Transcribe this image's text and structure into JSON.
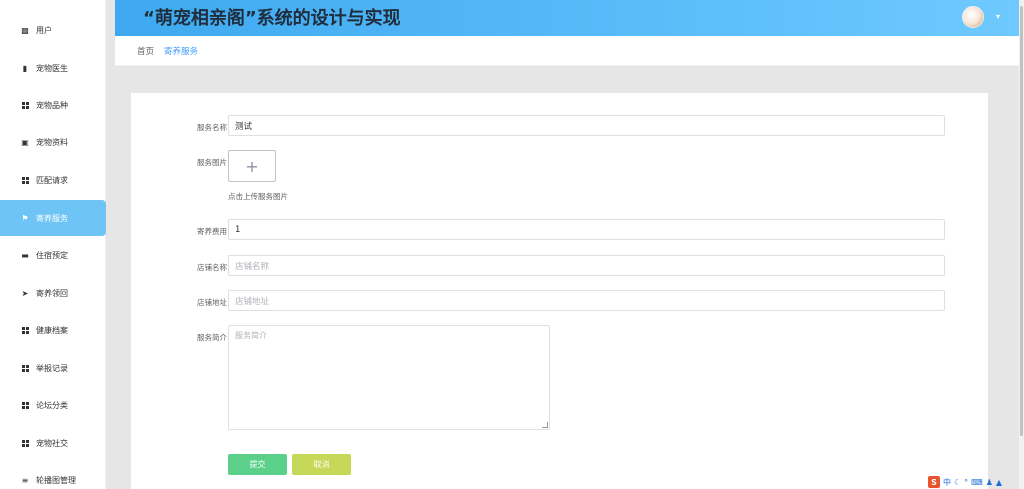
{
  "header": {
    "title": "“萌宠相亲阁”系统的设计与实现"
  },
  "sidebar": {
    "items": [
      {
        "label": "用户",
        "icon": "users-icon"
      },
      {
        "label": "宠物医生",
        "icon": "chart-icon"
      },
      {
        "label": "宠物品种",
        "icon": "grid-icon"
      },
      {
        "label": "宠物资料",
        "icon": "clipboard-icon"
      },
      {
        "label": "匹配请求",
        "icon": "grid-icon"
      },
      {
        "label": "寄养服务",
        "icon": "flag-icon",
        "active": true
      },
      {
        "label": "住宿预定",
        "icon": "card-icon"
      },
      {
        "label": "寄养领回",
        "icon": "send-icon"
      },
      {
        "label": "健康档案",
        "icon": "grid-icon"
      },
      {
        "label": "举报记录",
        "icon": "grid-icon"
      },
      {
        "label": "论坛分类",
        "icon": "grid-icon"
      },
      {
        "label": "宠物社交",
        "icon": "grid-icon"
      },
      {
        "label": "轮播图管理",
        "icon": "sliders-icon"
      }
    ]
  },
  "breadcrumb": {
    "home": "首页",
    "current": "寄养服务"
  },
  "form": {
    "service_name": {
      "label": "服务名称",
      "value": "测试"
    },
    "service_image": {
      "label": "服务图片",
      "upload_symbol": "+",
      "tip": "点击上传服务图片"
    },
    "fee": {
      "label": "寄养费用",
      "value": "1"
    },
    "shop_name": {
      "label": "店铺名称",
      "placeholder": "店铺名称"
    },
    "shop_address": {
      "label": "店铺地址",
      "placeholder": "店铺地址"
    },
    "intro": {
      "label": "服务简介",
      "placeholder": "服务简介"
    },
    "submit": "提交",
    "cancel": "取消"
  },
  "tray": {
    "ime": "S",
    "text": "中"
  },
  "colors": {
    "accent": "#409eff",
    "sidebar_active": "#6ec5f5",
    "submit": "#5ad08a",
    "cancel": "#c5d857"
  }
}
